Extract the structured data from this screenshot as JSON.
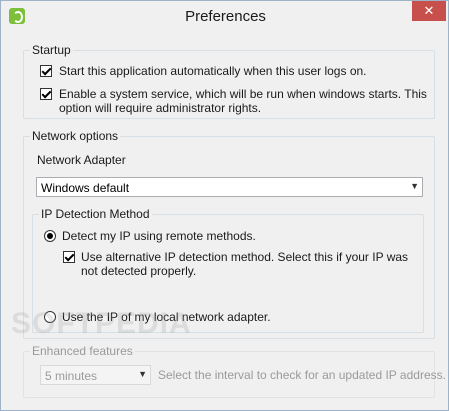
{
  "window": {
    "title": "Preferences",
    "close_glyph": "✕"
  },
  "startup": {
    "legend": "Startup",
    "auto_start_label": "Start this application automatically when this user logs on.",
    "auto_start_checked": true,
    "service_label_line1": "Enable a system service, which will be run when windows starts. This",
    "service_label_line2": "option will require administrator rights.",
    "service_checked": true
  },
  "network": {
    "legend": "Network options",
    "adapter_label": "Network Adapter",
    "adapter_value": "Windows default",
    "ip_detection": {
      "legend": "IP Detection Method",
      "remote_label": "Detect my IP using remote methods.",
      "remote_selected": true,
      "alt_label_line1": "Use alternative IP detection method. Select this if your IP was",
      "alt_label_line2": "not detected properly.",
      "alt_checked": true,
      "local_label": "Use the IP of my local network adapter.",
      "local_selected": false
    }
  },
  "enhanced": {
    "legend": "Enhanced features",
    "interval_value": "5 minutes",
    "interval_hint": "Select the interval to check for an updated IP address."
  },
  "watermark": "SOFTPEDIA",
  "colors": {
    "close_button": "#c7504c",
    "app_icon": "#7bbf3a"
  }
}
